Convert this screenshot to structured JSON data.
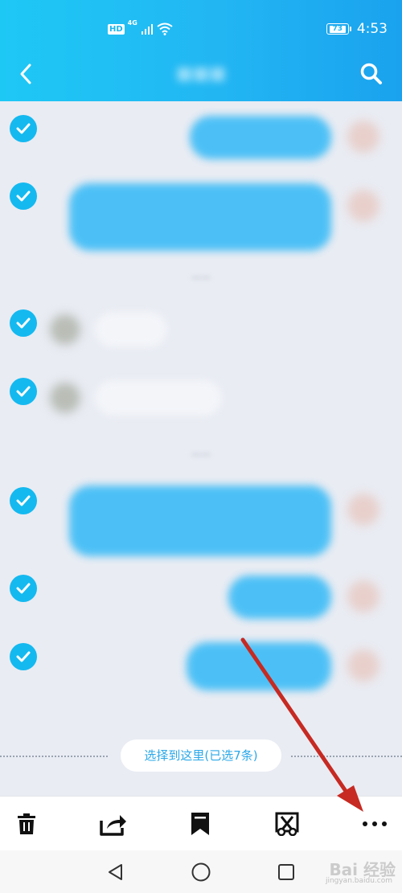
{
  "status_bar": {
    "hd_badge": "HD",
    "network": "4G",
    "battery": "73",
    "time": "4:53"
  },
  "header": {
    "back_icon": "chevron-left-icon",
    "search_icon": "search-icon"
  },
  "selection": {
    "banner_label": "选择到这里(已选7条)"
  },
  "toolbar": {
    "items": [
      {
        "icon": "trash-icon"
      },
      {
        "icon": "share-icon"
      },
      {
        "icon": "bookmark-icon"
      },
      {
        "icon": "screenshot-scissors-icon"
      },
      {
        "icon": "more-icon"
      }
    ]
  },
  "nav_bar": {
    "back_icon": "triangle-back-icon",
    "home_icon": "circle-home-icon",
    "recents_icon": "square-recents-icon"
  },
  "watermark": {
    "main": "Bai 经验",
    "sub": "jingyan.baidu.com"
  },
  "colors": {
    "accent": "#14b9f0",
    "header_start": "#1ec8f5",
    "header_end": "#1aa2ee",
    "bubble": "#4cc0f6",
    "annotation_arrow": "#c62a22"
  }
}
